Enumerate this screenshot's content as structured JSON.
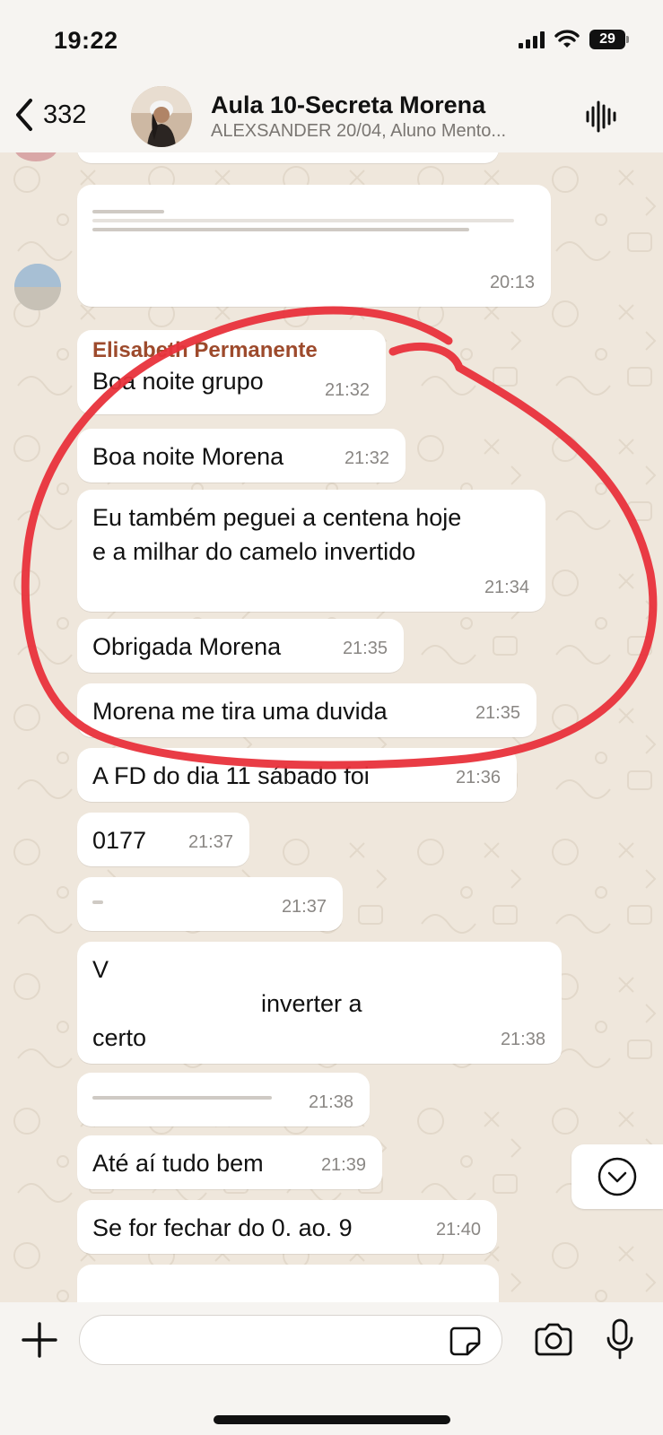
{
  "status_bar": {
    "time": "19:22",
    "battery": "29"
  },
  "header": {
    "back_count": "332",
    "title": "Aula 10-Secreta Morena",
    "subtitle": "ALEXSANDER 20/04, Aluno Mento..."
  },
  "messages": [
    {
      "text": "",
      "time": "20:13"
    },
    {
      "sender": "Elisabeth Permanente",
      "text": "Boa noite grupo",
      "time": "21:32"
    },
    {
      "text": "Boa noite Morena",
      "time": "21:32"
    },
    {
      "line1": "Eu também peguei a centena hoje",
      "line2": "e a milhar  do camelo invertido",
      "time": "21:34"
    },
    {
      "text": "Obrigada Morena",
      "time": "21:35"
    },
    {
      "text": "Morena me tira uma duvida",
      "time": "21:35"
    },
    {
      "text": "A FD do dia 11 sábado  foi",
      "time": "21:36"
    },
    {
      "text": "0177",
      "time": "21:37"
    },
    {
      "text": "",
      "time": "21:37"
    },
    {
      "line1": "V",
      "line2": "inverter a",
      "line3": "certo",
      "time": "21:38"
    },
    {
      "text": "",
      "time": "21:38"
    },
    {
      "text": "Até aí tudo bem",
      "time": "21:39"
    },
    {
      "text": "Se for fechar do 0. ao. 9",
      "time": "21:40"
    }
  ],
  "input": {
    "placeholder": ""
  },
  "colors": {
    "annotation": "#e8323b",
    "sender": "#9d4a2c",
    "bubble": "#ffffff",
    "background": "#efe7dc"
  },
  "icons": [
    "chevron-left-icon",
    "voice-wave-icon",
    "chevron-down-icon",
    "plus-icon",
    "sticker-icon",
    "camera-icon",
    "mic-icon"
  ]
}
